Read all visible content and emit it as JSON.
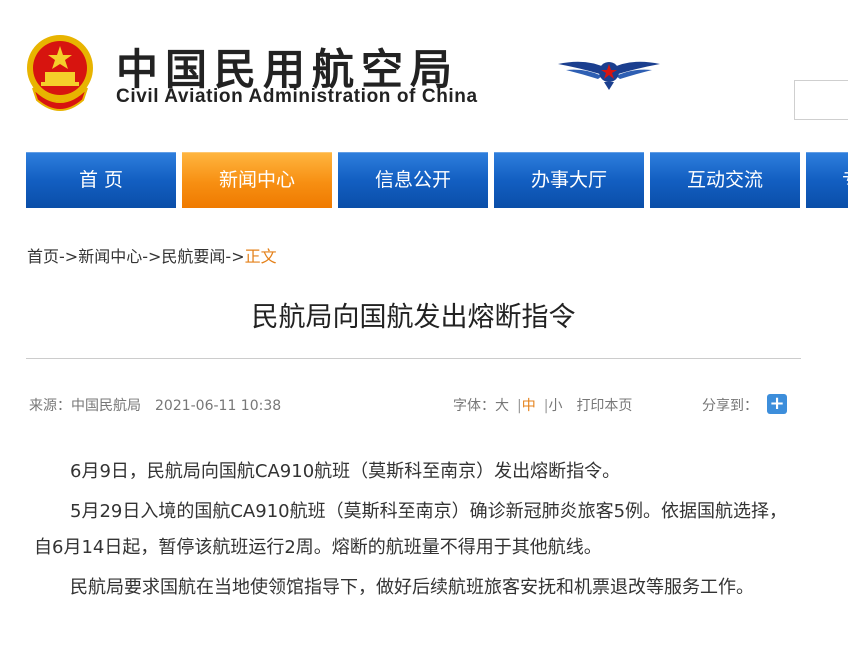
{
  "header": {
    "title_cn": "中国民用航空局",
    "title_en": "Civil Aviation Administration of China",
    "emblem_icon": "national-emblem-icon",
    "logo_icon": "caac-wings-logo-icon"
  },
  "nav": {
    "items": [
      {
        "label": "首 页"
      },
      {
        "label": "新闻中心"
      },
      {
        "label": "信息公开"
      },
      {
        "label": "办事大厅"
      },
      {
        "label": "互动交流"
      },
      {
        "label": "专"
      }
    ],
    "active_index": 1
  },
  "breadcrumb": {
    "items": [
      "首页",
      "新闻中心",
      "民航要闻"
    ],
    "separator": "->",
    "current": "正文"
  },
  "article": {
    "title": "民航局向国航发出熔断指令",
    "source": "来源：中国民航局",
    "date": "2021-06-11 10:38",
    "font_label": "字体：大",
    "font_medium": "中",
    "font_small": "小",
    "print_label": "打印本页",
    "share_label": "分享到：",
    "paragraphs": [
      "6月9日，民航局向国航CA910航班（莫斯科至南京）发出熔断指令。",
      "5月29日入境的国航CA910航班（莫斯科至南京）确诊新冠肺炎旅客5例。依据国航选择，自6月14日起，暂停该航班运行2周。熔断的航班量不得用于其他航线。",
      "民航局要求国航在当地使领馆指导下，做好后续航班旅客安抚和机票退改等服务工作。"
    ]
  },
  "colors": {
    "nav_blue": "#135fc2",
    "nav_active": "#f78f12",
    "accent_orange": "#e4811a"
  }
}
